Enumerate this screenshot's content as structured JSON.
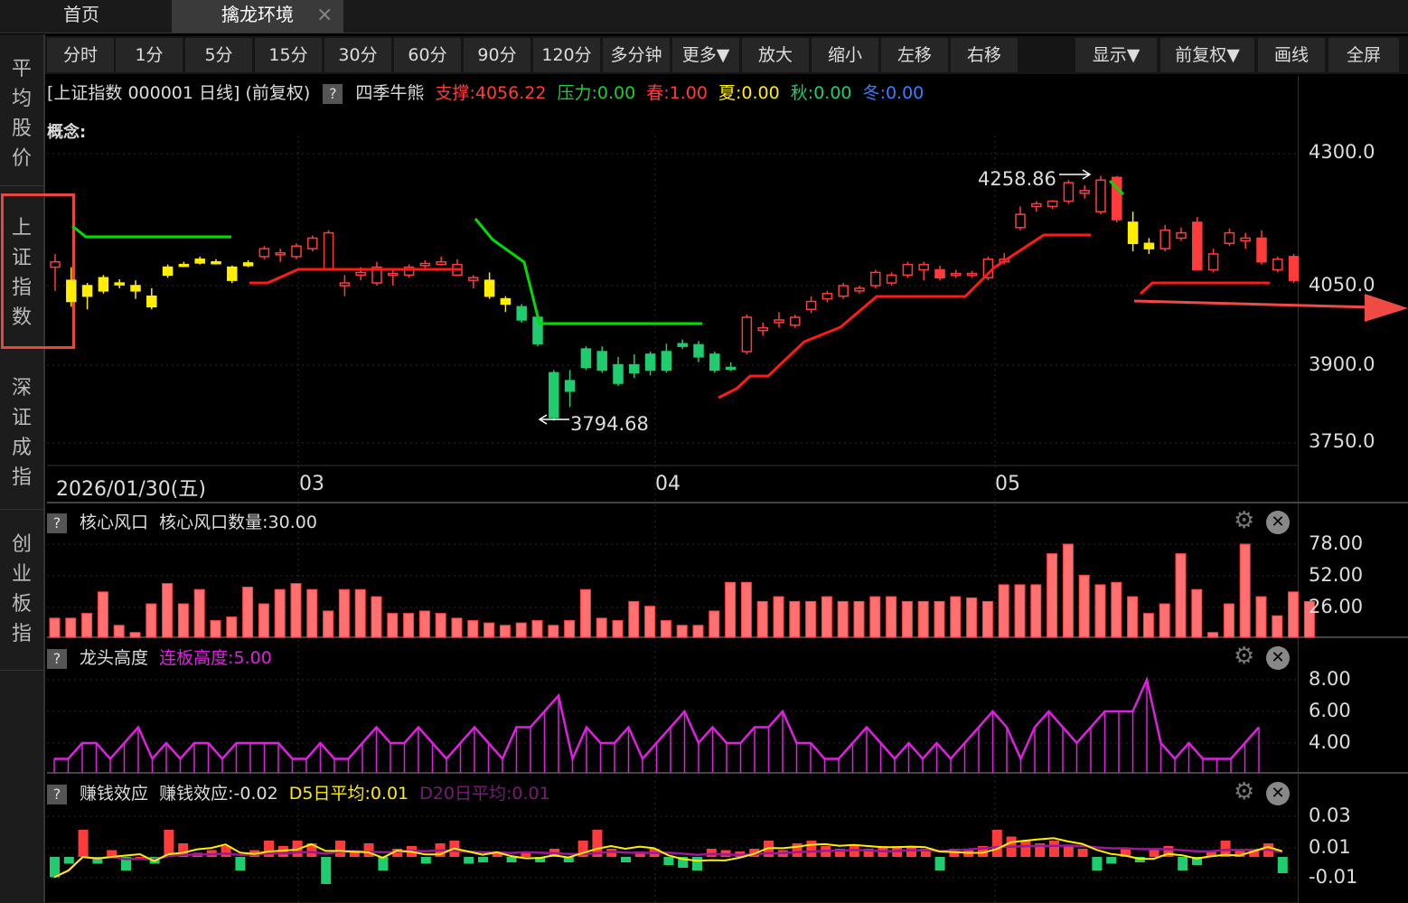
{
  "tabs": {
    "home": "首页",
    "active": "擒龙环境",
    "close": "×"
  },
  "leftnav": [
    {
      "label": "平\n均\n股\n价"
    },
    {
      "label": "上\n证\n指\n数"
    },
    {
      "label": "深\n证\n成\n指"
    },
    {
      "label": "创\n业\n板\n指"
    }
  ],
  "toolbar": {
    "periods": [
      "分时",
      "1分",
      "5分",
      "15分",
      "30分",
      "60分",
      "90分",
      "120分",
      "多分钟",
      "更多▼",
      "放大",
      "缩小",
      "左移",
      "右移"
    ],
    "right": [
      "显示▼",
      "前复权▼",
      "画线",
      "全屏"
    ]
  },
  "info": {
    "title": "[上证指数 000001 日线] (前复权)",
    "help": "?",
    "indicator": "四季牛熊",
    "support": "支撑:4056.22",
    "pressure": "压力:0.00",
    "spring": "春:1.00",
    "summer": "夏:0.00",
    "autumn": "秋:0.00",
    "winter": "冬:0.00",
    "concept": "概念:"
  },
  "colors": {
    "up": "#ff3b3b",
    "down": "#1fcc6e",
    "yellow": "#ffee00",
    "green_line": "#00dd00",
    "red_line": "#ff1a1a",
    "magenta": "#e020e0",
    "purple": "#9a1a9a",
    "annotation_arrow": "#f04a45"
  },
  "main_chart": {
    "y_ticks": [
      "4300.0",
      "4050.0",
      "3900.0",
      "3750.0"
    ],
    "x_labels": [
      "2026/01/30(五)",
      "03",
      "04",
      "05"
    ],
    "high_label": "4258.86",
    "low_label": "3794.68"
  },
  "panel1": {
    "help": "?",
    "name": "核心风口",
    "value": "核心风口数量:30.00",
    "y_ticks": [
      "78.00",
      "52.00",
      "26.00"
    ]
  },
  "panel2": {
    "help": "?",
    "name": "龙头高度",
    "value": "连板高度:5.00",
    "y_ticks": [
      "8.00",
      "6.00",
      "4.00"
    ]
  },
  "panel3": {
    "help": "?",
    "name": "赚钱效应",
    "value": "赚钱效应:-0.02",
    "d5": "D5日平均:0.01",
    "d20": "D20日平均:0.01",
    "y_ticks": [
      "0.03",
      "0.01",
      "-0.01"
    ]
  },
  "icons": {
    "gear": "gear-icon",
    "close": "close-icon",
    "arrow": "right-arrow-icon"
  },
  "chart_data": {
    "type": "candlestick",
    "title": "上证指数 000001 日线",
    "ylim": [
      3750,
      4300
    ],
    "candles": [
      {
        "o": 4085,
        "c": 4095,
        "h": 4110,
        "l": 4040,
        "color": "red"
      },
      {
        "o": 4060,
        "c": 4020,
        "h": 4085,
        "l": 4010,
        "color": "yellow"
      },
      {
        "o": 4030,
        "c": 4050,
        "h": 4055,
        "l": 4005,
        "color": "yellow"
      },
      {
        "o": 4040,
        "c": 4065,
        "h": 4070,
        "l": 4035,
        "color": "yellow"
      },
      {
        "o": 4055,
        "c": 4055,
        "h": 4062,
        "l": 4045,
        "color": "yellow"
      },
      {
        "o": 4040,
        "c": 4050,
        "h": 4060,
        "l": 4025,
        "color": "yellow"
      },
      {
        "o": 4010,
        "c": 4030,
        "h": 4045,
        "l": 4005,
        "color": "yellow"
      },
      {
        "o": 4070,
        "c": 4085,
        "h": 4090,
        "l": 4065,
        "color": "yellow"
      },
      {
        "o": 4090,
        "c": 4090,
        "h": 4095,
        "l": 4085,
        "color": "yellow"
      },
      {
        "o": 4093,
        "c": 4100,
        "h": 4105,
        "l": 4090,
        "color": "yellow"
      },
      {
        "o": 4095,
        "c": 4095,
        "h": 4100,
        "l": 4090,
        "color": "yellow"
      },
      {
        "o": 4085,
        "c": 4060,
        "h": 4088,
        "l": 4055,
        "color": "yellow"
      },
      {
        "o": 4088,
        "c": 4093,
        "h": 4098,
        "l": 4085,
        "color": "yellow"
      },
      {
        "o": 4105,
        "c": 4120,
        "h": 4125,
        "l": 4100,
        "color": "red"
      },
      {
        "o": 4110,
        "c": 4112,
        "h": 4120,
        "l": 4095,
        "color": "red"
      },
      {
        "o": 4105,
        "c": 4125,
        "h": 4130,
        "l": 4100,
        "color": "red"
      },
      {
        "o": 4120,
        "c": 4140,
        "h": 4145,
        "l": 4115,
        "color": "red"
      },
      {
        "o": 4080,
        "c": 4150,
        "h": 4155,
        "l": 4078,
        "color": "red"
      },
      {
        "o": 4050,
        "c": 4055,
        "h": 4070,
        "l": 4030,
        "color": "red"
      },
      {
        "o": 4070,
        "c": 4075,
        "h": 4085,
        "l": 4060,
        "color": "red"
      },
      {
        "o": 4055,
        "c": 4085,
        "h": 4095,
        "l": 4050,
        "color": "red"
      },
      {
        "o": 4070,
        "c": 4073,
        "h": 4080,
        "l": 4050,
        "color": "red"
      },
      {
        "o": 4070,
        "c": 4085,
        "h": 4090,
        "l": 4065,
        "color": "red"
      },
      {
        "o": 4088,
        "c": 4092,
        "h": 4098,
        "l": 4082,
        "color": "red"
      },
      {
        "o": 4090,
        "c": 4095,
        "h": 4105,
        "l": 4088,
        "color": "red"
      },
      {
        "o": 4070,
        "c": 4090,
        "h": 4100,
        "l": 4068,
        "color": "red"
      },
      {
        "o": 4060,
        "c": 4065,
        "h": 4070,
        "l": 4045,
        "color": "red"
      },
      {
        "o": 4060,
        "c": 4030,
        "h": 4075,
        "l": 4025,
        "color": "yellow"
      },
      {
        "o": 4025,
        "c": 4015,
        "h": 4030,
        "l": 4000,
        "color": "yellow"
      },
      {
        "o": 4010,
        "c": 3985,
        "h": 4015,
        "l": 3980,
        "color": "green"
      },
      {
        "o": 3990,
        "c": 3940,
        "h": 3995,
        "l": 3935,
        "color": "green"
      },
      {
        "o": 3885,
        "c": 3800,
        "h": 3890,
        "l": 3794,
        "color": "green"
      },
      {
        "o": 3850,
        "c": 3870,
        "h": 3890,
        "l": 3820,
        "color": "green"
      },
      {
        "o": 3895,
        "c": 3930,
        "h": 3935,
        "l": 3890,
        "color": "green"
      },
      {
        "o": 3925,
        "c": 3890,
        "h": 3935,
        "l": 3885,
        "color": "green"
      },
      {
        "o": 3900,
        "c": 3865,
        "h": 3915,
        "l": 3860,
        "color": "green"
      },
      {
        "o": 3885,
        "c": 3900,
        "h": 3920,
        "l": 3875,
        "color": "green"
      },
      {
        "o": 3890,
        "c": 3920,
        "h": 3925,
        "l": 3880,
        "color": "green"
      },
      {
        "o": 3925,
        "c": 3890,
        "h": 3940,
        "l": 3885,
        "color": "green"
      },
      {
        "o": 3935,
        "c": 3940,
        "h": 3948,
        "l": 3930,
        "color": "green"
      },
      {
        "o": 3938,
        "c": 3915,
        "h": 3945,
        "l": 3905,
        "color": "green"
      },
      {
        "o": 3920,
        "c": 3890,
        "h": 3925,
        "l": 3885,
        "color": "green"
      },
      {
        "o": 3895,
        "c": 3895,
        "h": 3905,
        "l": 3888,
        "color": "green"
      },
      {
        "o": 3925,
        "c": 3990,
        "h": 3995,
        "l": 3920,
        "color": "red"
      },
      {
        "o": 3965,
        "c": 3970,
        "h": 3980,
        "l": 3955,
        "color": "red"
      },
      {
        "o": 3980,
        "c": 3985,
        "h": 4000,
        "l": 3970,
        "color": "red"
      },
      {
        "o": 3975,
        "c": 3990,
        "h": 3995,
        "l": 3970,
        "color": "red"
      },
      {
        "o": 4005,
        "c": 4020,
        "h": 4030,
        "l": 3998,
        "color": "red"
      },
      {
        "o": 4025,
        "c": 4035,
        "h": 4040,
        "l": 4018,
        "color": "red"
      },
      {
        "o": 4030,
        "c": 4050,
        "h": 4055,
        "l": 4025,
        "color": "red"
      },
      {
        "o": 4040,
        "c": 4045,
        "h": 4050,
        "l": 4035,
        "color": "red"
      },
      {
        "o": 4050,
        "c": 4075,
        "h": 4080,
        "l": 4045,
        "color": "red"
      },
      {
        "o": 4055,
        "c": 4070,
        "h": 4075,
        "l": 4050,
        "color": "red"
      },
      {
        "o": 4070,
        "c": 4090,
        "h": 4095,
        "l": 4065,
        "color": "red"
      },
      {
        "o": 4080,
        "c": 4090,
        "h": 4095,
        "l": 4060,
        "color": "red"
      },
      {
        "o": 4080,
        "c": 4065,
        "h": 4088,
        "l": 4060,
        "color": "red"
      },
      {
        "o": 4070,
        "c": 4073,
        "h": 4080,
        "l": 4065,
        "color": "red"
      },
      {
        "o": 4070,
        "c": 4073,
        "h": 4078,
        "l": 4065,
        "color": "red"
      },
      {
        "o": 4065,
        "c": 4100,
        "h": 4105,
        "l": 4060,
        "color": "red"
      },
      {
        "o": 4095,
        "c": 4100,
        "h": 4112,
        "l": 4090,
        "color": "red"
      },
      {
        "o": 4160,
        "c": 4185,
        "h": 4200,
        "l": 4155,
        "color": "red"
      },
      {
        "o": 4200,
        "c": 4205,
        "h": 4210,
        "l": 4190,
        "color": "red"
      },
      {
        "o": 4200,
        "c": 4210,
        "h": 4212,
        "l": 4195,
        "color": "red"
      },
      {
        "o": 4210,
        "c": 4245,
        "h": 4250,
        "l": 4205,
        "color": "red"
      },
      {
        "o": 4225,
        "c": 4230,
        "h": 4240,
        "l": 4215,
        "color": "red"
      },
      {
        "o": 4190,
        "c": 4250,
        "h": 4258,
        "l": 4185,
        "color": "red"
      },
      {
        "o": 4255,
        "c": 4175,
        "h": 4258,
        "l": 4170,
        "color": "red"
      },
      {
        "o": 4170,
        "c": 4130,
        "h": 4190,
        "l": 4115,
        "color": "yellow"
      },
      {
        "o": 4130,
        "c": 4120,
        "h": 4140,
        "l": 4110,
        "color": "yellow"
      },
      {
        "o": 4120,
        "c": 4155,
        "h": 4165,
        "l": 4115,
        "color": "red"
      },
      {
        "o": 4140,
        "c": 4150,
        "h": 4160,
        "l": 4135,
        "color": "red"
      },
      {
        "o": 4170,
        "c": 4080,
        "h": 4180,
        "l": 4078,
        "color": "red"
      },
      {
        "o": 4080,
        "c": 4110,
        "h": 4120,
        "l": 4075,
        "color": "red"
      },
      {
        "o": 4130,
        "c": 4150,
        "h": 4158,
        "l": 4125,
        "color": "red"
      },
      {
        "o": 4135,
        "c": 4140,
        "h": 4150,
        "l": 4120,
        "color": "red"
      },
      {
        "o": 4140,
        "c": 4095,
        "h": 4155,
        "l": 4090,
        "color": "red"
      },
      {
        "o": 4080,
        "c": 4100,
        "h": 4105,
        "l": 4075,
        "color": "red"
      },
      {
        "o": 4105,
        "c": 4060,
        "h": 4110,
        "l": 4055,
        "color": "red"
      }
    ],
    "panel1_values": [
      16,
      16,
      20,
      38,
      10,
      4,
      28,
      45,
      28,
      40,
      14,
      17,
      42,
      28,
      40,
      45,
      40,
      22,
      40,
      40,
      34,
      20,
      20,
      22,
      20,
      16,
      14,
      12,
      10,
      12,
      14,
      10,
      14,
      40,
      16,
      14,
      30,
      26,
      14,
      10,
      10,
      22,
      46,
      46,
      30,
      34,
      30,
      30,
      34,
      30,
      30,
      34,
      34,
      30,
      30,
      30,
      34,
      33,
      30,
      44,
      44,
      44,
      70,
      78,
      52,
      44,
      46,
      34,
      20,
      28,
      70,
      40,
      4,
      28,
      78,
      34,
      18,
      38,
      30
    ],
    "panel2_values": [
      3,
      3,
      4,
      4,
      3,
      4,
      5,
      3,
      4,
      3,
      4,
      4,
      3,
      4,
      4,
      4,
      4,
      3,
      3,
      4,
      3,
      3,
      4,
      5,
      4,
      4,
      5,
      4,
      3,
      4,
      5,
      4,
      3,
      5,
      5,
      6,
      7,
      3,
      5,
      4,
      4,
      5,
      3,
      4,
      5,
      6,
      4,
      5,
      4,
      4,
      5,
      5,
      6,
      4,
      4,
      3,
      3,
      4,
      5,
      4,
      3,
      4,
      3,
      4,
      3,
      4,
      5,
      6,
      5,
      3,
      5,
      6,
      5,
      4,
      5,
      6,
      6,
      6,
      8,
      4,
      3,
      4,
      3,
      3,
      3,
      4,
      5
    ],
    "panel3_bars": [
      -0.015,
      -0.005,
      0.02,
      -0.005,
      0.005,
      -0.01,
      0,
      -0.005,
      0.02,
      0.01,
      0.003,
      0.005,
      0.008,
      -0.01,
      0.005,
      0.012,
      0.008,
      0.012,
      0.01,
      -0.02,
      0.012,
      0.005,
      0.01,
      -0.01,
      0.006,
      0.008,
      -0.005,
      0.01,
      0.012,
      -0.005,
      -0.004,
      0.004,
      -0.004,
      0.004,
      -0.004,
      0.006,
      -0.004,
      0.012,
      0.02,
      0.006,
      -0.004,
      0.004,
      0.006,
      -0.006,
      -0.008,
      -0.01,
      0.006,
      0.005,
      0.004,
      0.006,
      0.012,
      0.005,
      0.01,
      0.012,
      0.008,
      0.006,
      0.008,
      0.006,
      0.008,
      0.008,
      0.008,
      0.006,
      -0.01,
      0.006,
      0.005,
      0.008,
      0.02,
      0.015,
      0.012,
      0.01,
      0.012,
      0.008,
      0.006,
      -0.01,
      -0.005,
      0.006,
      -0.004,
      0.006,
      0.008,
      -0.01,
      -0.006,
      0.004,
      0.012,
      0.005,
      0.006,
      0.01,
      -0.012
    ]
  }
}
